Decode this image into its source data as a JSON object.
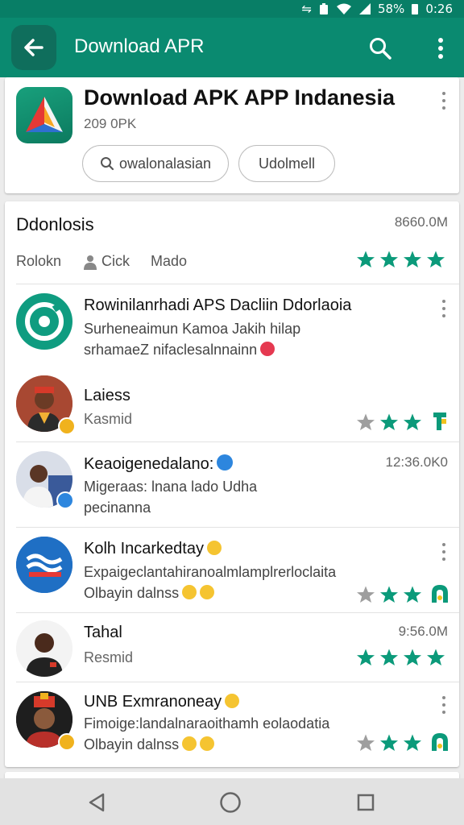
{
  "status_bar": {
    "battery": "58%",
    "time": "0:26"
  },
  "app_bar": {
    "title": "Download APR",
    "icons": [
      "back-arrow-icon",
      "search-icon",
      "more-vert-icon"
    ]
  },
  "app_card": {
    "name": "Download APK APP Indanesia",
    "subtitle": "209 0PK",
    "chip_search": "owalonalasian",
    "chip_download": "Udolmell"
  },
  "section": {
    "title": "Ddonlosis",
    "size": "8660.0M",
    "meta": [
      "Rolokn",
      "Cick",
      "Mado"
    ]
  },
  "rows": [
    {
      "title": "Rowinilanrhadi APS Dacliin Ddorlaoia",
      "line1": "Surheneaimun Kamoa Jakih hilap",
      "line2": "srhamaeZ nifaclesalnnainn",
      "time": ""
    },
    {
      "title": "Laiess",
      "line1": "Kasmid",
      "line2": "",
      "time": ""
    },
    {
      "title": "Keaoigenedalano:",
      "line1": "Migeraas: lnana lado Udha",
      "line2": "pecinanna",
      "time": "12:36.0K0"
    },
    {
      "title": "Kolh Incarkedtay",
      "line1": "Expaigeclantahiranoalmlamplrerloclaita",
      "line2": "Olbayin dalnss",
      "time": ""
    },
    {
      "title": "Tahal",
      "line1": "Resmid",
      "line2": "",
      "time": "9:56.0M"
    },
    {
      "title": "UNB Exmranoneay",
      "line1": "Fimoige:landalnaraoithamh eolaodatia",
      "line2": "Olbayin dalnss",
      "time": ""
    }
  ],
  "colors": {
    "primary": "#0a8a70",
    "primary_dark": "#087e66",
    "star": "#0b9a7a",
    "star_empty": "#9e9e9e"
  }
}
